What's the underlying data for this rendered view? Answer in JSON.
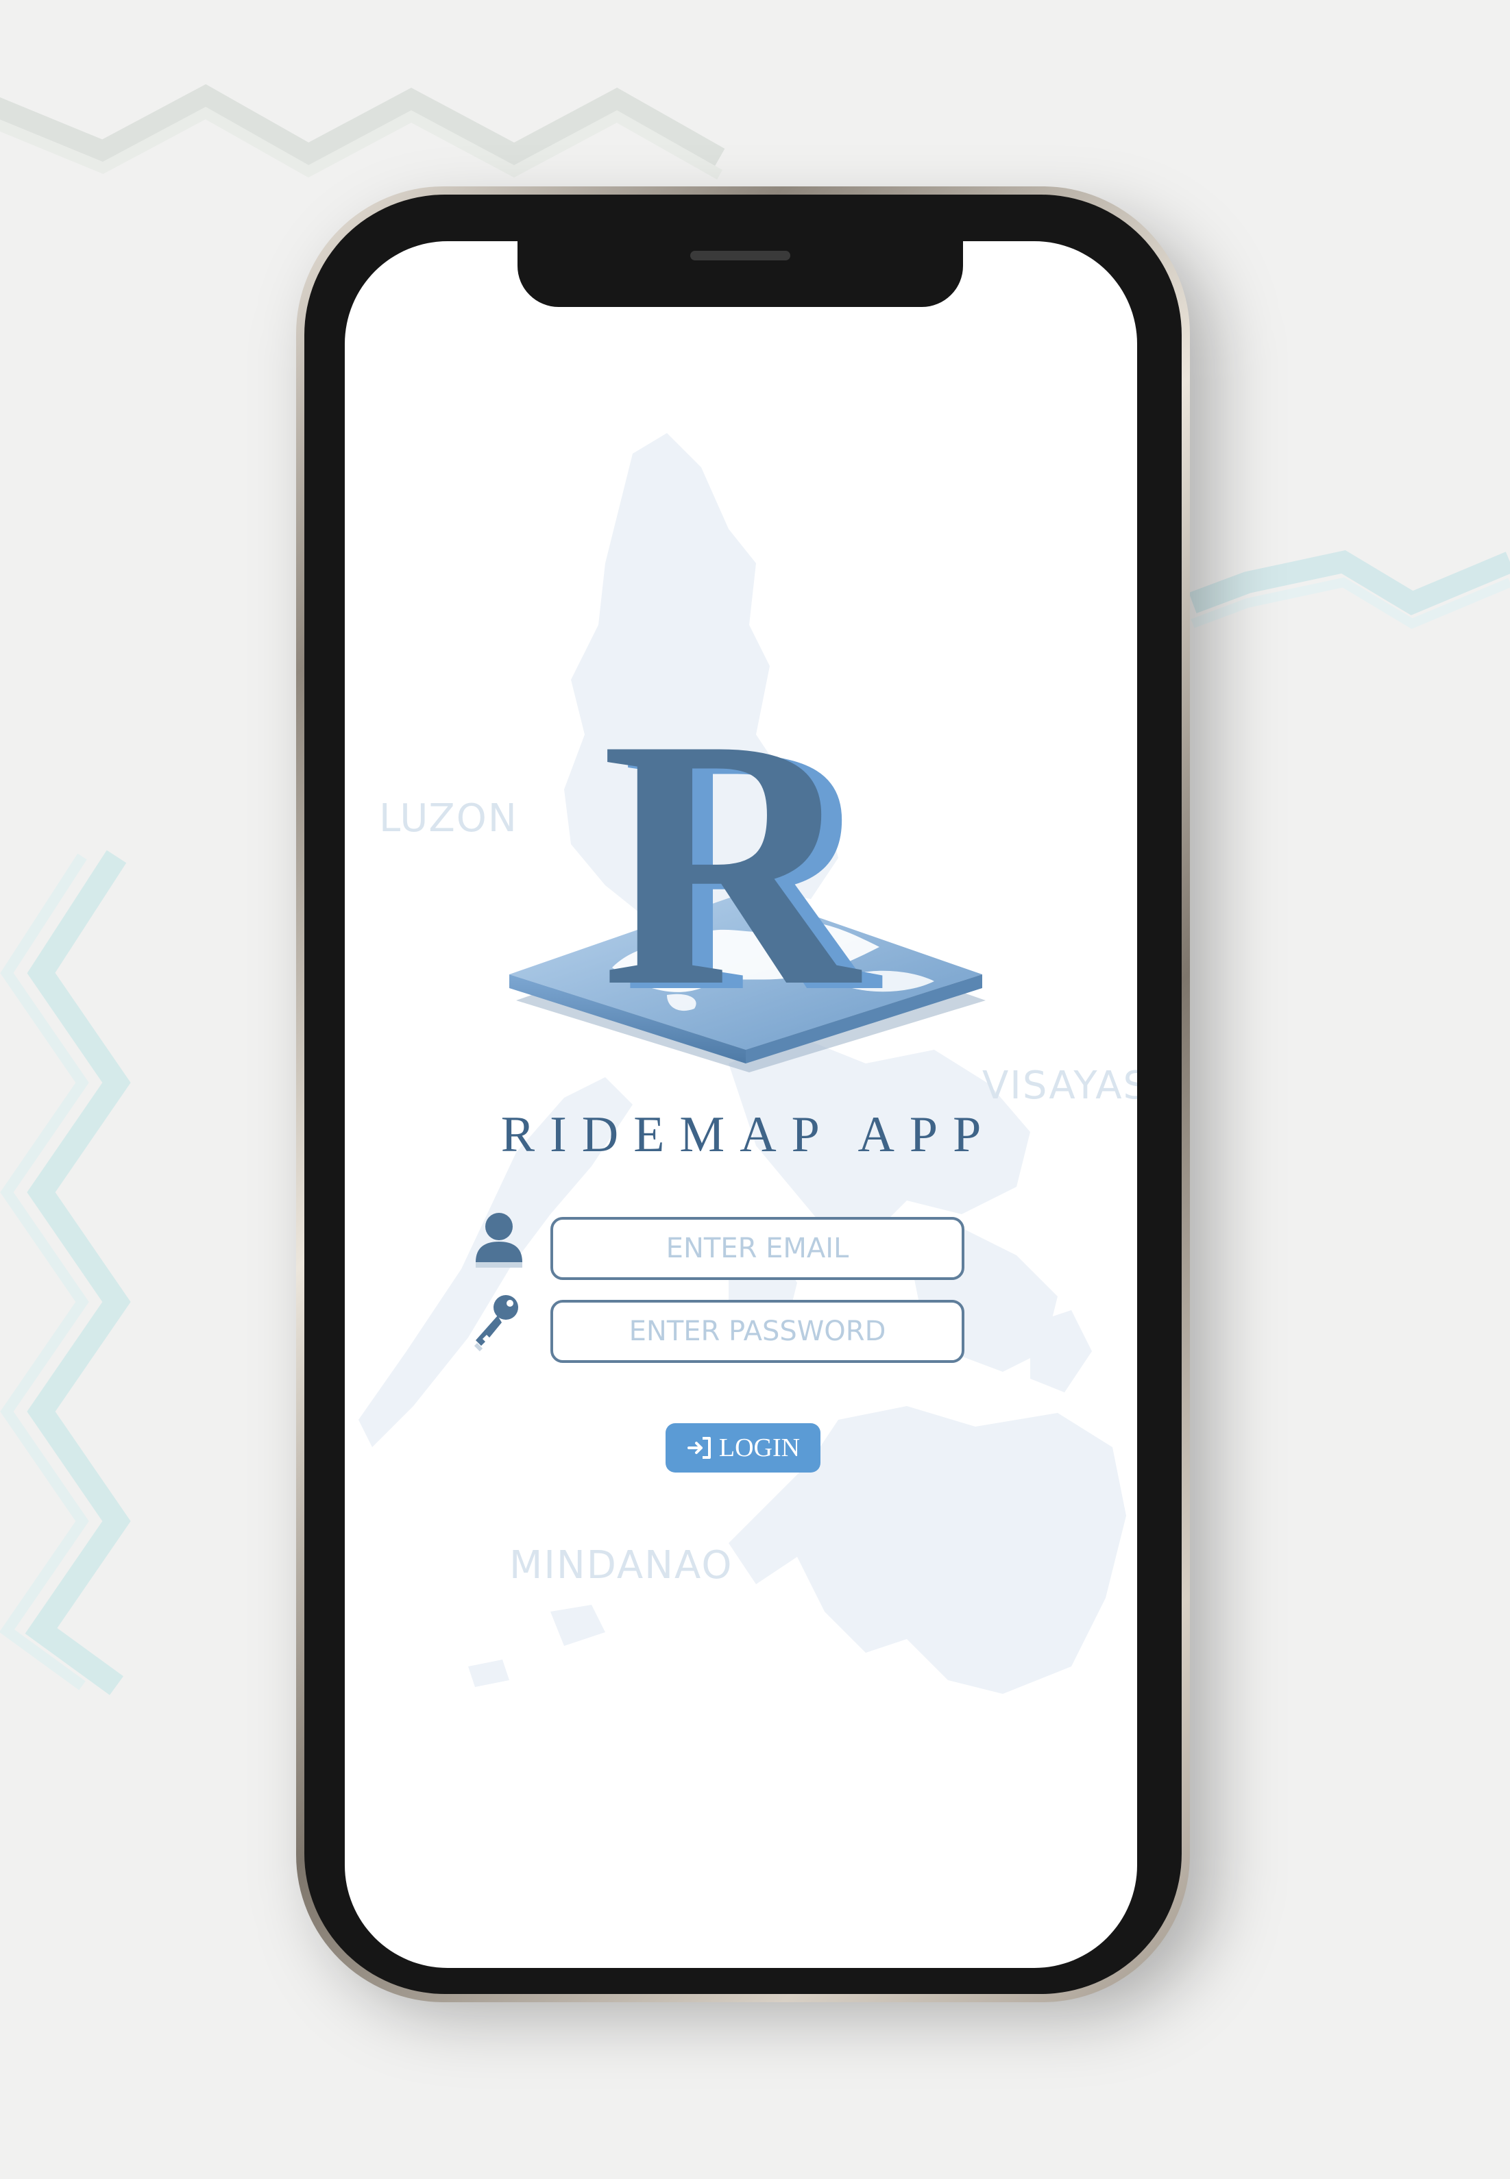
{
  "app": {
    "title": "RIDEMAP APP",
    "logo_letter": "R"
  },
  "map_labels": {
    "luzon": "LUZON",
    "visayas": "VISAYAS",
    "mindanao": "MINDANAO"
  },
  "login_form": {
    "email": {
      "placeholder": "ENTER EMAIL",
      "value": "",
      "icon": "user-icon"
    },
    "password": {
      "placeholder": "ENTER PASSWORD",
      "value": "",
      "icon": "key-icon"
    },
    "login_label": "LOGIN",
    "login_icon": "sign-in-icon"
  },
  "colors": {
    "primary": "#3f6488",
    "logo_dark": "#4e7396",
    "logo_light": "#6a9ed3",
    "button": "#5b9bd5",
    "field_border": "#5f7e9b",
    "placeholder": "#b8cde0",
    "map_tint": "#edf2f8"
  }
}
